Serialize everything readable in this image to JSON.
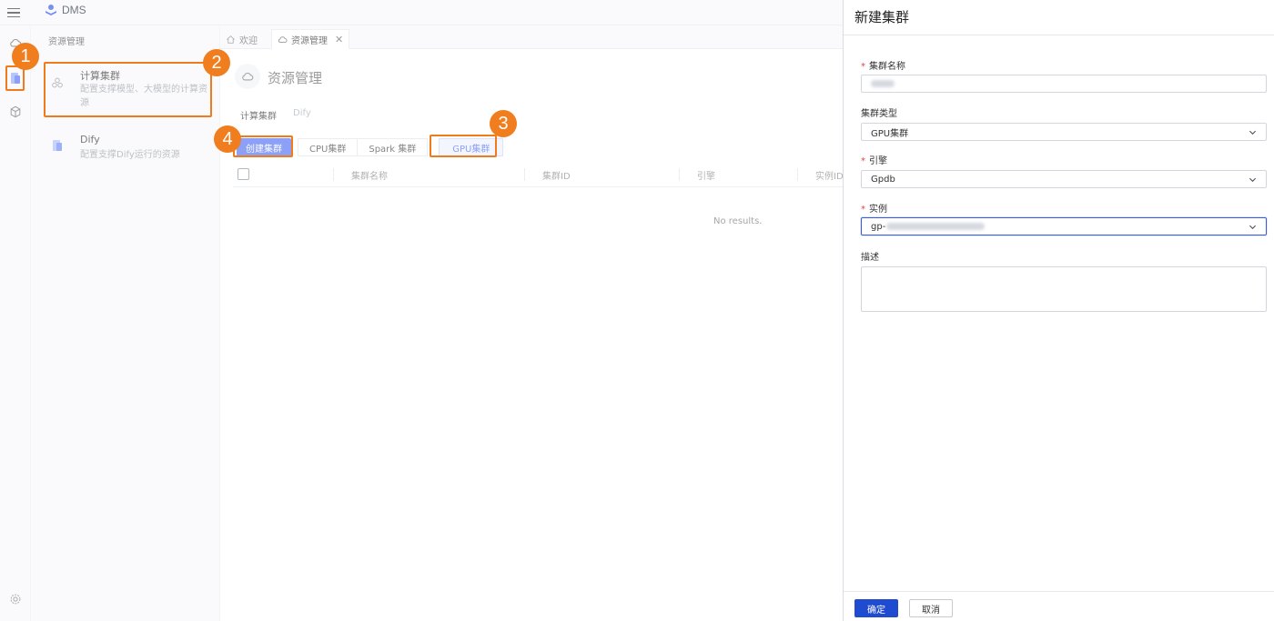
{
  "app": {
    "brand": "DMS"
  },
  "subpanel": {
    "title": "资源管理",
    "cards": [
      {
        "title": "计算集群",
        "desc": "配置支撑模型、大模型的计算资源"
      },
      {
        "title": "Dify",
        "desc": "配置支撑Dify运行的资源"
      }
    ]
  },
  "tabs": [
    {
      "label": "欢迎",
      "icon": "home-icon"
    },
    {
      "label": "资源管理",
      "icon": "cloud-icon",
      "close": "✕"
    }
  ],
  "main": {
    "title": "资源管理",
    "subtabs": [
      "计算集群",
      "Dify"
    ],
    "create_button": "创建集群",
    "filters": [
      "CPU集群",
      "Spark 集群",
      "GPU集群"
    ],
    "selected_filter": "GPU集群",
    "columns": [
      "集群名称",
      "集群ID",
      "引擎",
      "实例ID"
    ],
    "empty_text": "No results."
  },
  "annotations": [
    "1",
    "2",
    "3",
    "4"
  ],
  "drawer": {
    "title": "新建集群",
    "fields": {
      "name": {
        "label": "集群名称",
        "required": true
      },
      "type": {
        "label": "集群类型",
        "value": "GPU集群"
      },
      "engine": {
        "label": "引擎",
        "required": true,
        "value": "Gpdb"
      },
      "instance": {
        "label": "实例",
        "required": true,
        "value_prefix": "gp-"
      },
      "desc": {
        "label": "描述"
      }
    },
    "required_mark": "*",
    "ok": "确定",
    "cancel": "取消"
  },
  "colors": {
    "accent": "#4e6ef2",
    "annotation": "#f07d1e",
    "primary_dark": "#1f4bd1"
  }
}
